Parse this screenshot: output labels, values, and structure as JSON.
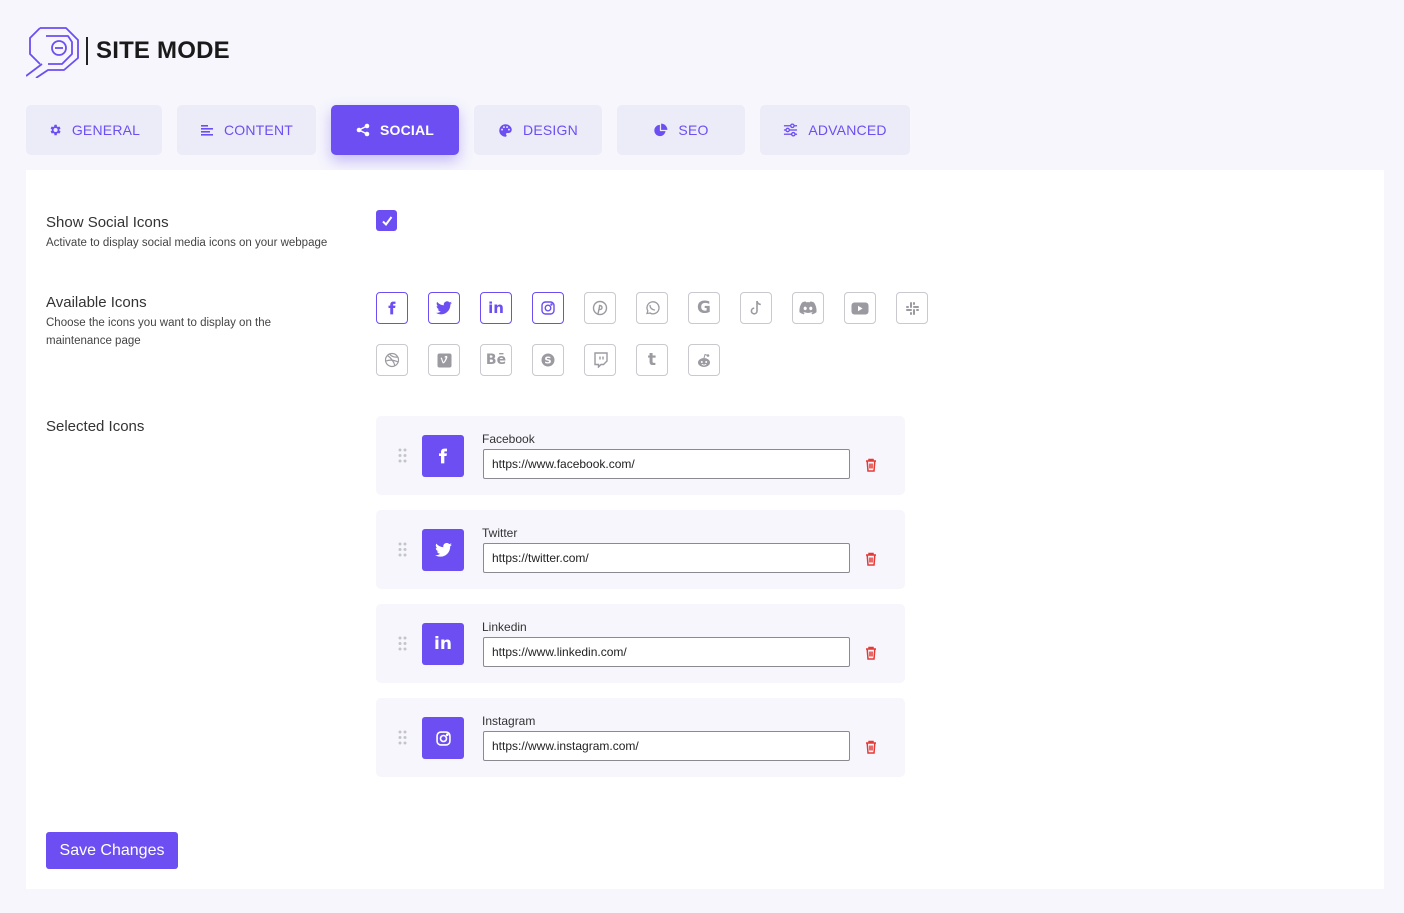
{
  "brand": {
    "name": "SITE MODE",
    "accent": "#6c4ef2"
  },
  "tabs": [
    {
      "label": "GENERAL",
      "icon": "gear-icon"
    },
    {
      "label": "CONTENT",
      "icon": "align-left-icon"
    },
    {
      "label": "SOCIAL",
      "icon": "share-icon",
      "active": true
    },
    {
      "label": "DESIGN",
      "icon": "palette-icon"
    },
    {
      "label": "SEO",
      "icon": "pie-chart-icon"
    },
    {
      "label": "ADVANCED",
      "icon": "sliders-icon"
    }
  ],
  "show_social": {
    "title": "Show Social Icons",
    "description": "Activate to display social media icons on your webpage",
    "checked": true
  },
  "available": {
    "title": "Available Icons",
    "description_line1": "Choose the icons you want to display on the",
    "description_line2": "maintenance page",
    "icons": [
      {
        "name": "facebook",
        "selected": true
      },
      {
        "name": "twitter",
        "selected": true
      },
      {
        "name": "linkedin",
        "selected": true
      },
      {
        "name": "instagram",
        "selected": true
      },
      {
        "name": "pinterest",
        "selected": false
      },
      {
        "name": "whatsapp",
        "selected": false
      },
      {
        "name": "google",
        "selected": false
      },
      {
        "name": "tiktok",
        "selected": false
      },
      {
        "name": "discord",
        "selected": false
      },
      {
        "name": "youtube",
        "selected": false
      },
      {
        "name": "slack",
        "selected": false
      },
      {
        "name": "dribbble",
        "selected": false
      },
      {
        "name": "vimeo",
        "selected": false
      },
      {
        "name": "behance",
        "selected": false
      },
      {
        "name": "skype",
        "selected": false
      },
      {
        "name": "twitch",
        "selected": false
      },
      {
        "name": "tumblr",
        "selected": false
      },
      {
        "name": "reddit",
        "selected": false
      }
    ]
  },
  "selected": {
    "title": "Selected Icons",
    "items": [
      {
        "name": "Facebook",
        "icon": "facebook-icon",
        "url": "https://www.facebook.com/"
      },
      {
        "name": "Twitter",
        "icon": "twitter-icon",
        "url": "https://twitter.com/"
      },
      {
        "name": "Linkedin",
        "icon": "linkedin-icon",
        "url": "https://www.linkedin.com/"
      },
      {
        "name": "Instagram",
        "icon": "instagram-icon",
        "url": "https://www.instagram.com/"
      }
    ]
  },
  "save_label": "Save Changes"
}
